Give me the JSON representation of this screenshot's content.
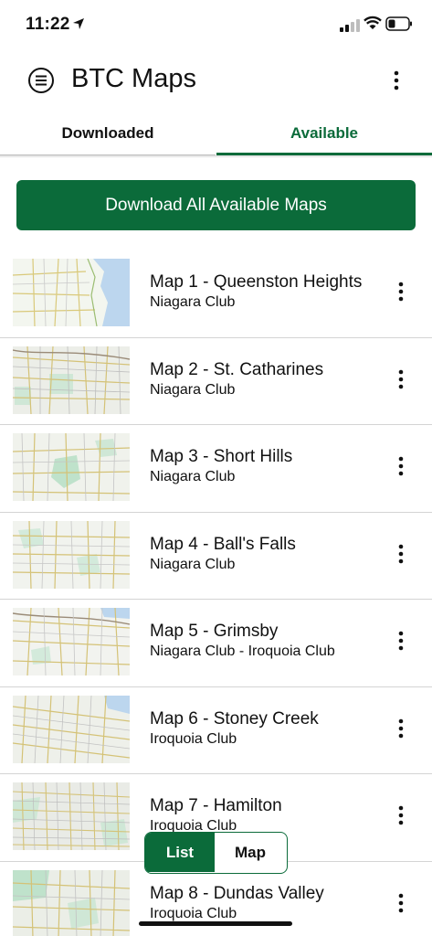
{
  "status_bar": {
    "time": "11:22"
  },
  "app_bar": {
    "title": "BTC Maps"
  },
  "tabs": [
    {
      "label": "Downloaded",
      "active": false
    },
    {
      "label": "Available",
      "active": true
    }
  ],
  "download_all_label": "Download All Available Maps",
  "maps": [
    {
      "name": "Map 1 - Queenston Heights",
      "club": "Niagara Club"
    },
    {
      "name": "Map 2 - St. Catharines",
      "club": "Niagara Club"
    },
    {
      "name": "Map 3 - Short Hills",
      "club": "Niagara Club"
    },
    {
      "name": "Map 4 - Ball's Falls",
      "club": "Niagara Club"
    },
    {
      "name": "Map 5 - Grimsby",
      "club": "Niagara Club - Iroquoia Club"
    },
    {
      "name": "Map 6 - Stoney Creek",
      "club": "Iroquoia Club"
    },
    {
      "name": "Map 7 - Hamilton",
      "club": "Iroquoia Club"
    },
    {
      "name": "Map 8 - Dundas Valley",
      "club": "Iroquoia Club"
    }
  ],
  "view_toggle": {
    "list_label": "List",
    "map_label": "Map",
    "selected": "List"
  },
  "colors": {
    "accent": "#0b6b3a",
    "divider": "#d4d4d4"
  },
  "icons": {
    "menu": "menu-icon",
    "more": "more-vertical-icon",
    "location": "location-arrow-icon",
    "signal": "cellular-signal-icon",
    "wifi": "wifi-icon",
    "battery": "battery-icon"
  }
}
